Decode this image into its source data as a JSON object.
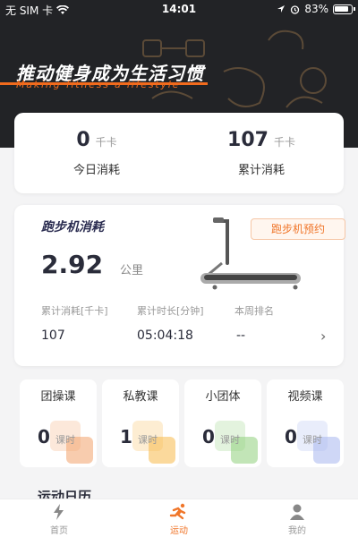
{
  "status_bar": {
    "carrier": "无 SIM 卡",
    "time": "14:01",
    "battery": "83%"
  },
  "header": {
    "slogan": "推动健身成为生活习惯",
    "slogan_en": "Making fitness a lifestyle"
  },
  "calories": {
    "today": {
      "value": "0",
      "unit": "千卡",
      "label": "今日消耗"
    },
    "total": {
      "value": "107",
      "unit": "千卡",
      "label": "累计消耗"
    }
  },
  "treadmill": {
    "title": "跑步机消耗",
    "booking_label": "跑步机预约",
    "distance": "2.92",
    "distance_unit": "公里",
    "stats": [
      {
        "label": "累计消耗[千卡]",
        "value": "107"
      },
      {
        "label": "累计时长[分钟]",
        "value": "05:04:18"
      },
      {
        "label": "本周排名",
        "value": "--"
      }
    ]
  },
  "courses": [
    {
      "title": "团操课",
      "count": "0",
      "unit": "课时",
      "color": "#f3a36b"
    },
    {
      "title": "私教课",
      "count": "1",
      "unit": "课时",
      "color": "#f7b94a"
    },
    {
      "title": "小团体",
      "count": "0",
      "unit": "课时",
      "color": "#8fd07c"
    },
    {
      "title": "视频课",
      "count": "0",
      "unit": "课时",
      "color": "#a8b6ee"
    }
  ],
  "sport_calendar": {
    "title": "运动日历"
  },
  "tabbar": {
    "items": [
      {
        "label": "首页",
        "icon": "lightning-icon"
      },
      {
        "label": "运动",
        "icon": "running-icon"
      },
      {
        "label": "我的",
        "icon": "person-icon"
      }
    ],
    "active_color": "#f0762a"
  },
  "accent": "#f26b1d"
}
